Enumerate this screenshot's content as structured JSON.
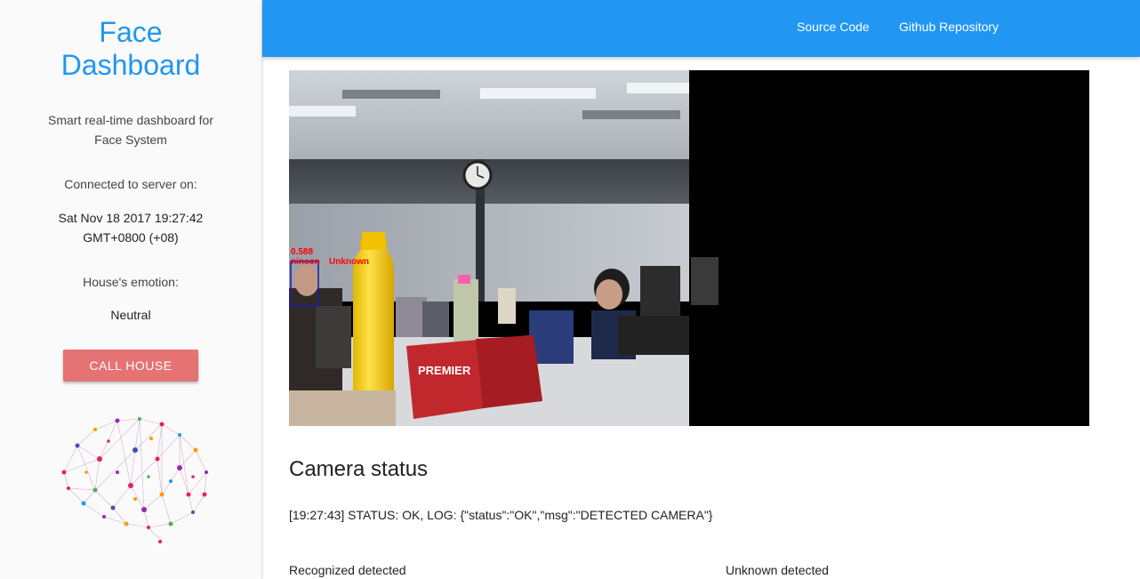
{
  "sidebar": {
    "brand_line1": "Face",
    "brand_line2": "Dashboard",
    "tagline": "Smart real-time dashboard for Face System",
    "connected_label": "Connected to server on:",
    "timestamp": "Sat Nov 18 2017 19:27:42 GMT+0800 (+08)",
    "emotion_label": "House's emotion:",
    "emotion_value": "Neutral",
    "call_button": "CALL HOUSE",
    "logo_icon": "brain-network-icon"
  },
  "topbar": {
    "source_code": "Source Code",
    "github_repo": "Github Repository"
  },
  "feed": {
    "detection_score": "0.588",
    "detection_name": "nincon",
    "detection_label": "Unknown",
    "product_brand": "PREMIER"
  },
  "camera": {
    "title": "Camera status",
    "log": "[19:27:43] STATUS: OK, LOG: {\"status\":\"OK\",\"msg\":\"DETECTED CAMERA\"}"
  },
  "stats": {
    "recognized_label": "Recognized detected",
    "unknown_label": "Unknown detected"
  },
  "colors": {
    "primary": "#2196f3",
    "call_button": "#e57373",
    "detection_box": "#ff0000"
  }
}
